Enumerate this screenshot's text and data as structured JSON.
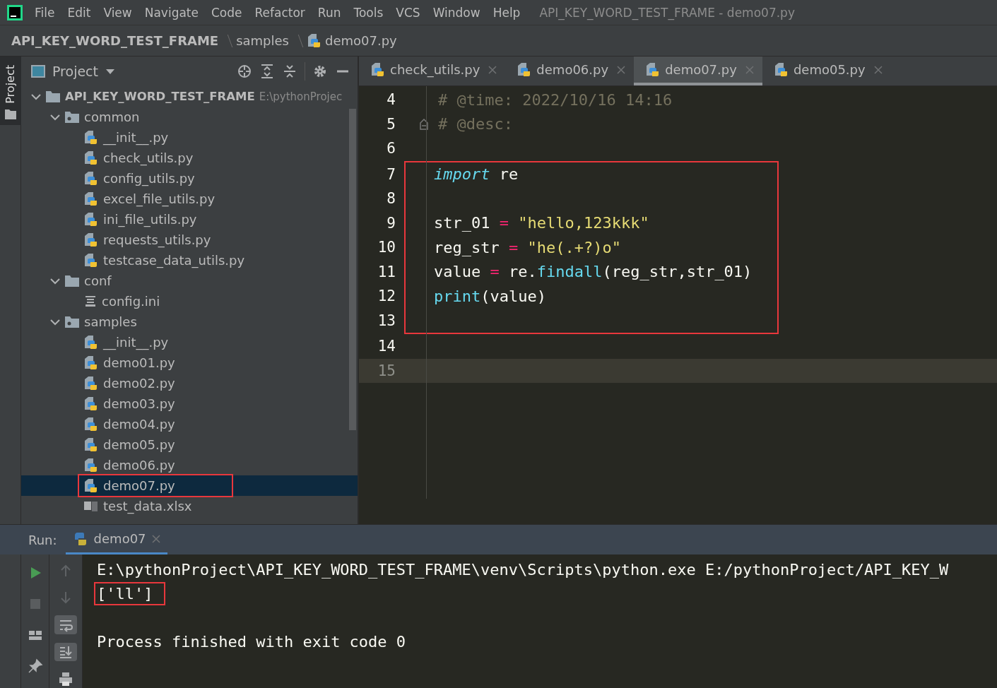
{
  "menu_bar": {
    "items": [
      "File",
      "Edit",
      "View",
      "Navigate",
      "Code",
      "Refactor",
      "Run",
      "Tools",
      "VCS",
      "Window",
      "Help"
    ],
    "title": "API_KEY_WORD_TEST_FRAME - demo07.py"
  },
  "breadcrumb": [
    {
      "label": "API_KEY_WORD_TEST_FRAME",
      "kind": "project"
    },
    {
      "label": "samples",
      "kind": "folder"
    },
    {
      "label": "demo07.py",
      "kind": "python"
    }
  ],
  "side_strip": {
    "label": "Project"
  },
  "project_panel": {
    "title": "Project",
    "tree": [
      {
        "name": "API_KEY_WORD_TEST_FRAME",
        "path": "E:\\pythonProjec",
        "kind": "root",
        "expanded": true,
        "selected": false,
        "children": [
          {
            "name": "common",
            "kind": "package",
            "expanded": true,
            "selected": false,
            "children": [
              {
                "name": "__init__.py",
                "kind": "python",
                "selected": false
              },
              {
                "name": "check_utils.py",
                "kind": "python",
                "selected": false
              },
              {
                "name": "config_utils.py",
                "kind": "python",
                "selected": false
              },
              {
                "name": "excel_file_utils.py",
                "kind": "python",
                "selected": false
              },
              {
                "name": "ini_file_utils.py",
                "kind": "python",
                "selected": false
              },
              {
                "name": "requests_utils.py",
                "kind": "python",
                "selected": false
              },
              {
                "name": "testcase_data_utils.py",
                "kind": "python",
                "selected": false
              }
            ]
          },
          {
            "name": "conf",
            "kind": "folder",
            "expanded": true,
            "selected": false,
            "children": [
              {
                "name": "config.ini",
                "kind": "ini",
                "selected": false
              }
            ]
          },
          {
            "name": "samples",
            "kind": "package",
            "expanded": true,
            "selected": false,
            "children": [
              {
                "name": "__init__.py",
                "kind": "python",
                "selected": false
              },
              {
                "name": "demo01.py",
                "kind": "python",
                "selected": false
              },
              {
                "name": "demo02.py",
                "kind": "python",
                "selected": false
              },
              {
                "name": "demo03.py",
                "kind": "python",
                "selected": false
              },
              {
                "name": "demo04.py",
                "kind": "python",
                "selected": false
              },
              {
                "name": "demo05.py",
                "kind": "python",
                "selected": false
              },
              {
                "name": "demo06.py",
                "kind": "python",
                "selected": false
              },
              {
                "name": "demo07.py",
                "kind": "python",
                "selected": true,
                "outlined": true
              },
              {
                "name": "test_data.xlsx",
                "kind": "excel",
                "selected": false
              }
            ]
          }
        ]
      }
    ]
  },
  "editor_tabs": [
    {
      "label": "check_utils.py",
      "selected": false
    },
    {
      "label": "demo06.py",
      "selected": false
    },
    {
      "label": "demo07.py",
      "selected": true
    },
    {
      "label": "demo05.py",
      "selected": false
    }
  ],
  "code_lines": [
    {
      "number": "4",
      "tokens": [
        {
          "kind": "comment",
          "text": "# @time: 2022/10/16 14:16"
        }
      ]
    },
    {
      "number": "5",
      "fold": true,
      "tokens": [
        {
          "kind": "comment",
          "text": "# @desc:"
        }
      ]
    },
    {
      "number": "6"
    },
    {
      "number": "7",
      "boxed": true,
      "tokens": [
        {
          "kind": "keyword",
          "text": "import"
        },
        {
          "kind": "plain",
          "text": " re"
        }
      ]
    },
    {
      "number": "8",
      "boxed": true
    },
    {
      "number": "9",
      "boxed": true,
      "tokens": [
        {
          "kind": "plain",
          "text": "str_01 "
        },
        {
          "kind": "operator",
          "text": "="
        },
        {
          "kind": "string",
          "text": " \"hello,123kkk\""
        }
      ]
    },
    {
      "number": "10",
      "boxed": true,
      "tokens": [
        {
          "kind": "plain",
          "text": "reg_str "
        },
        {
          "kind": "operator",
          "text": "="
        },
        {
          "kind": "string",
          "text": " \"he(.+?)o\""
        }
      ]
    },
    {
      "number": "11",
      "boxed": true,
      "tokens": [
        {
          "kind": "plain",
          "text": "value "
        },
        {
          "kind": "operator",
          "text": "="
        },
        {
          "kind": "plain",
          "text": " re."
        },
        {
          "kind": "call",
          "text": "findall"
        },
        {
          "kind": "plain",
          "text": "(reg_str,str_01)"
        }
      ]
    },
    {
      "number": "12",
      "boxed": true,
      "tokens": [
        {
          "kind": "call",
          "text": "print"
        },
        {
          "kind": "plain",
          "text": "(value)"
        }
      ]
    },
    {
      "number": "13",
      "boxed": true
    },
    {
      "number": "14"
    },
    {
      "number": "15",
      "current": true
    }
  ],
  "run_panel": {
    "label": "Run:",
    "tab": {
      "label": "demo07",
      "selected": true
    },
    "console": [
      {
        "kind": "command",
        "text": "E:\\pythonProject\\API_KEY_WORD_TEST_FRAME\\venv\\Scripts\\python.exe E:/pythonProject/API_KEY_W",
        "outlined": false
      },
      {
        "kind": "output",
        "text": "['ll']",
        "outlined": true
      },
      {
        "kind": "status",
        "text": "Process finished with exit code 0",
        "outlined": false
      }
    ]
  }
}
